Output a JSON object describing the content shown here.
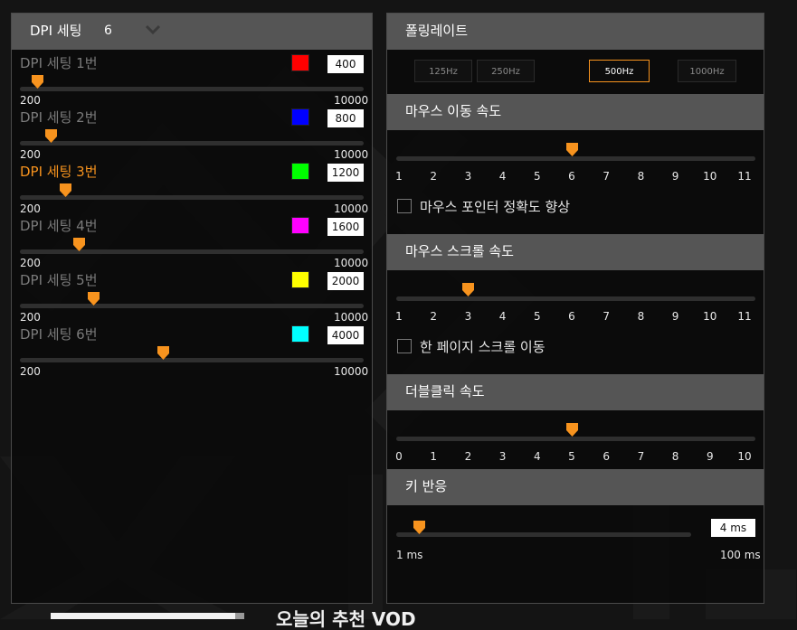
{
  "dpi_panel": {
    "title": "DPI 세팅",
    "count": "6",
    "rows": [
      {
        "label": "DPI 세팅 1번",
        "color": "#ff0000",
        "value": "400",
        "min": "200",
        "max": "10000",
        "fraction": 0.02,
        "active": false
      },
      {
        "label": "DPI 세팅 2번",
        "color": "#0000ff",
        "value": "800",
        "min": "200",
        "max": "10000",
        "fraction": 0.061,
        "active": false
      },
      {
        "label": "DPI 세팅 3번",
        "color": "#00ff00",
        "value": "1200",
        "min": "200",
        "max": "10000",
        "fraction": 0.102,
        "active": true
      },
      {
        "label": "DPI 세팅 4번",
        "color": "#ff00ff",
        "value": "1600",
        "min": "200",
        "max": "10000",
        "fraction": 0.143,
        "active": false
      },
      {
        "label": "DPI 세팅 5번",
        "color": "#ffff00",
        "value": "2000",
        "min": "200",
        "max": "10000",
        "fraction": 0.184,
        "active": false
      },
      {
        "label": "DPI 세팅 6번",
        "color": "#00ffff",
        "value": "4000",
        "min": "200",
        "max": "10000",
        "fraction": 0.388,
        "active": false
      }
    ]
  },
  "polling": {
    "title": "폴링레이트",
    "options": [
      "125Hz",
      "250Hz",
      "500Hz",
      "1000Hz"
    ],
    "selected": "500Hz"
  },
  "mouse_speed": {
    "title": "마우스 이동 속도",
    "ticks": [
      "1",
      "2",
      "3",
      "4",
      "5",
      "6",
      "7",
      "8",
      "9",
      "10",
      "11"
    ],
    "value": 6,
    "checkbox_label": "마우스 포인터 정확도 향상",
    "checked": false
  },
  "scroll_speed": {
    "title": "마우스 스크롤 속도",
    "ticks": [
      "1",
      "2",
      "3",
      "4",
      "5",
      "6",
      "7",
      "8",
      "9",
      "10",
      "11"
    ],
    "value": 3,
    "checkbox_label": "한 페이지 스크롤 이동",
    "checked": false
  },
  "double_click": {
    "title": "더블클릭 속도",
    "ticks": [
      "0",
      "1",
      "2",
      "3",
      "4",
      "5",
      "6",
      "7",
      "8",
      "9",
      "10"
    ],
    "value": 5
  },
  "key_response": {
    "title": "키 반응",
    "value_label": "4 ms",
    "min_label": "1 ms",
    "max_label": "100 ms",
    "fraction": 0.03
  },
  "below": {
    "text": "오늘의 추천 VOD"
  },
  "colors": {
    "accent": "#f7931e",
    "header": "#555555",
    "track": "#2f2f2f"
  }
}
